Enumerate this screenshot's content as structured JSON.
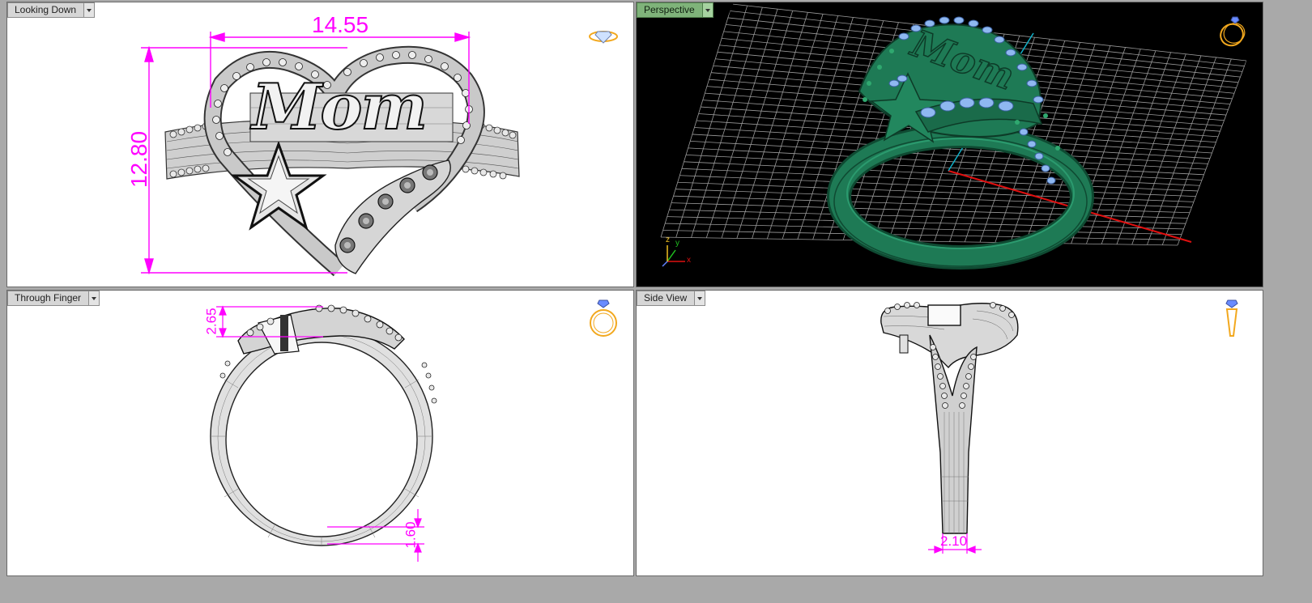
{
  "viewports": {
    "top_left": {
      "label": "Looking Down",
      "dim_width": "14.55",
      "dim_height": "12.80",
      "engraving": "Mom"
    },
    "top_right": {
      "label": "Perspective",
      "engraving": "Mom",
      "axis_x": "x",
      "axis_y": "y",
      "axis_z": "z"
    },
    "bottom_left": {
      "label": "Through Finger",
      "dim_top": "2.65",
      "dim_bottom": "1.60"
    },
    "bottom_right": {
      "label": "Side View",
      "dim_shank": "2.10"
    }
  },
  "icons": {
    "view_menu": "chevron-down-icon",
    "top_view_nav": "ring-top-icon",
    "perspective_nav": "ring-perspective-icon",
    "front_nav": "ring-front-icon",
    "side_nav": "ring-side-icon"
  },
  "colors": {
    "dimension": "#ff00ff",
    "active_tab": "#7fb37a",
    "render_green": "#1e7a55",
    "stone_blue": "#8fb8f0",
    "grid": "#9a9a9a",
    "axis_x": "#e01010",
    "axis_y": "#10b0c8",
    "nav_icon": "#f2a81e"
  }
}
